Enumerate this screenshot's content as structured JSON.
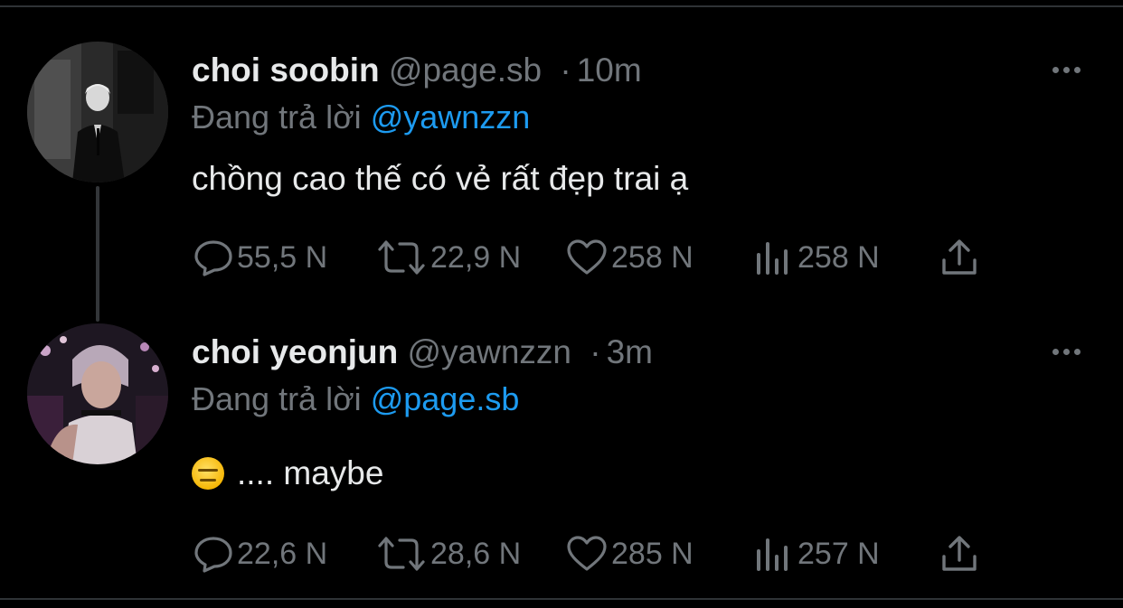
{
  "tweets": [
    {
      "name": "choi soobin",
      "handle": "@page.sb",
      "separator": "·",
      "time": "10m",
      "replying_prefix": "Đang trả lời",
      "replying_to": "@yawnzzn",
      "text": "chồng cao thế có vẻ rất đẹp trai ạ",
      "emoji": "",
      "stats": {
        "replies": "55,5 N",
        "retweets": "22,9 N",
        "likes": "258 N",
        "views": "258 N"
      }
    },
    {
      "name": "choi yeonjun",
      "handle": "@yawnzzn",
      "separator": "·",
      "time": "3m",
      "replying_prefix": "Đang trả lời",
      "replying_to": "@page.sb",
      "text": ".... maybe",
      "emoji": "expressionless-face",
      "stats": {
        "replies": "22,6 N",
        "retweets": "28,6 N",
        "likes": "285 N",
        "views": "257 N"
      }
    }
  ],
  "colors": {
    "background": "#000000",
    "text": "#e7e9ea",
    "muted": "#71767b",
    "accent": "#1d9bf0",
    "divider": "#2f3336"
  },
  "icons": [
    "reply-icon",
    "retweet-icon",
    "like-icon",
    "views-icon",
    "share-icon",
    "more-icon",
    "expressionless-face-emoji"
  ]
}
